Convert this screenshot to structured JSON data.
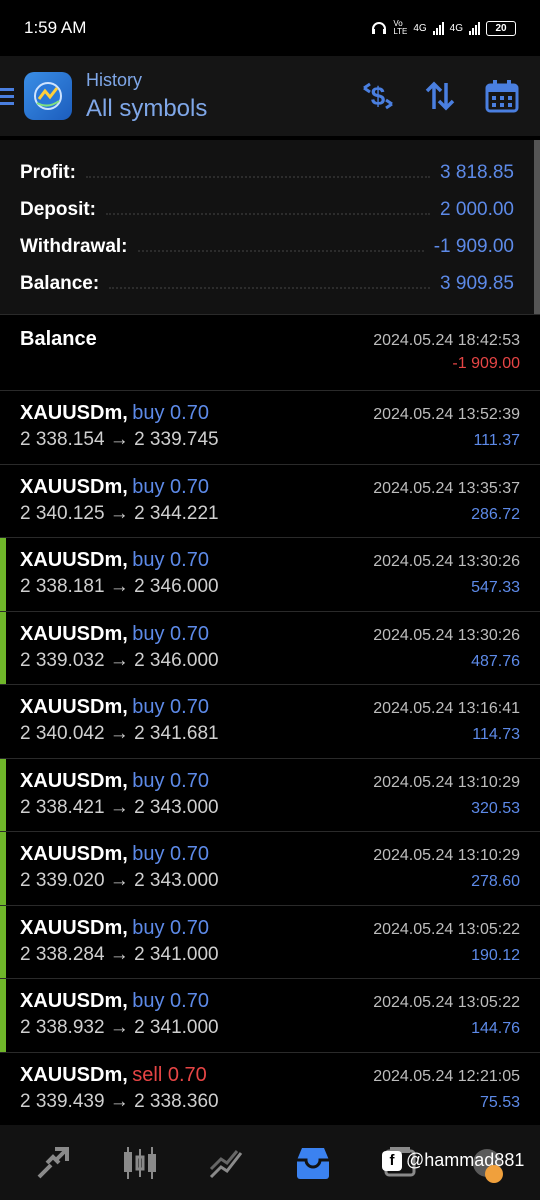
{
  "status_bar": {
    "time": "1:59 AM",
    "network_1": "4G",
    "network_2": "4G",
    "volte": "Vo LTE",
    "battery": "20"
  },
  "header": {
    "subtitle": "History",
    "title": "All symbols",
    "icons": [
      "menu-icon",
      "app-logo-icon",
      "dollar-swap-icon",
      "sort-icon",
      "calendar-icon"
    ]
  },
  "summary": {
    "profit_label": "Profit:",
    "profit_value": "3 818.85",
    "deposit_label": "Deposit:",
    "deposit_value": "2 000.00",
    "withdrawal_label": "Withdrawal:",
    "withdrawal_value": "-1 909.00",
    "balance_label": "Balance:",
    "balance_value": "3 909.85"
  },
  "balance_entry": {
    "title": "Balance",
    "time": "2024.05.24 18:42:53",
    "amount": "-1 909.00"
  },
  "trades": [
    {
      "symbol": "XAUUSDm,",
      "direction": "buy 0.70",
      "type": "buy",
      "prices": "2 338.154 → 2 339.745",
      "time": "2024.05.24 13:52:39",
      "profit": "111.37",
      "marked": false
    },
    {
      "symbol": "XAUUSDm,",
      "direction": "buy 0.70",
      "type": "buy",
      "prices": "2 340.125 → 2 344.221",
      "time": "2024.05.24 13:35:37",
      "profit": "286.72",
      "marked": false
    },
    {
      "symbol": "XAUUSDm,",
      "direction": "buy 0.70",
      "type": "buy",
      "prices": "2 338.181 → 2 346.000",
      "time": "2024.05.24 13:30:26",
      "profit": "547.33",
      "marked": true
    },
    {
      "symbol": "XAUUSDm,",
      "direction": "buy 0.70",
      "type": "buy",
      "prices": "2 339.032 → 2 346.000",
      "time": "2024.05.24 13:30:26",
      "profit": "487.76",
      "marked": true
    },
    {
      "symbol": "XAUUSDm,",
      "direction": "buy 0.70",
      "type": "buy",
      "prices": "2 340.042 → 2 341.681",
      "time": "2024.05.24 13:16:41",
      "profit": "114.73",
      "marked": false
    },
    {
      "symbol": "XAUUSDm,",
      "direction": "buy 0.70",
      "type": "buy",
      "prices": "2 338.421 → 2 343.000",
      "time": "2024.05.24 13:10:29",
      "profit": "320.53",
      "marked": true
    },
    {
      "symbol": "XAUUSDm,",
      "direction": "buy 0.70",
      "type": "buy",
      "prices": "2 339.020 → 2 343.000",
      "time": "2024.05.24 13:10:29",
      "profit": "278.60",
      "marked": true
    },
    {
      "symbol": "XAUUSDm,",
      "direction": "buy 0.70",
      "type": "buy",
      "prices": "2 338.284 → 2 341.000",
      "time": "2024.05.24 13:05:22",
      "profit": "190.12",
      "marked": true
    },
    {
      "symbol": "XAUUSDm,",
      "direction": "buy 0.70",
      "type": "buy",
      "prices": "2 338.932 → 2 341.000",
      "time": "2024.05.24 13:05:22",
      "profit": "144.76",
      "marked": true
    },
    {
      "symbol": "XAUUSDm,",
      "direction": "sell 0.70",
      "type": "sell",
      "prices": "2 339.439 → 2 338.360",
      "time": "2024.05.24 12:21:05",
      "profit": "75.53",
      "marked": false
    }
  ],
  "bottom_nav": {
    "items": [
      "quotes-icon",
      "chart-icon",
      "trade-icon",
      "history-icon",
      "messages-icon",
      "settings-icon"
    ],
    "active": "history-icon"
  },
  "watermark": "@hammad881",
  "colors": {
    "accent": "#5d8ae8",
    "negative": "#e64545",
    "marker": "#6fb62a",
    "background": "#000000"
  }
}
